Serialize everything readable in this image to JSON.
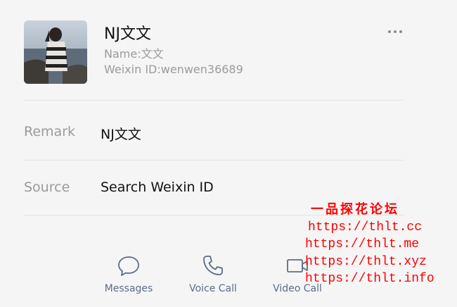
{
  "profile": {
    "display_name": "NJ文文",
    "name_line": "Name:文文",
    "weixin_id_line": "Weixin ID:wenwen36689",
    "avatar_icon": "user-photo"
  },
  "more_icon": "more-dots-icon",
  "rows": [
    {
      "label": "Remark",
      "value": "NJ文文"
    },
    {
      "label": "Source",
      "value": "Search Weixin ID"
    }
  ],
  "actions": [
    {
      "label": "Messages",
      "icon": "chat-bubble-icon"
    },
    {
      "label": "Voice Call",
      "icon": "phone-icon"
    },
    {
      "label": "Video Call",
      "icon": "video-icon"
    }
  ],
  "watermark": {
    "title": "一品探花论坛",
    "urls": [
      "https://thlt.cc",
      "https://thlt.me",
      "https://thlt.xyz",
      "https://thlt.info"
    ]
  },
  "colors": {
    "background": "#f5f5f5",
    "action_blue": "#5c6d87",
    "watermark_red": "#ff0000"
  }
}
